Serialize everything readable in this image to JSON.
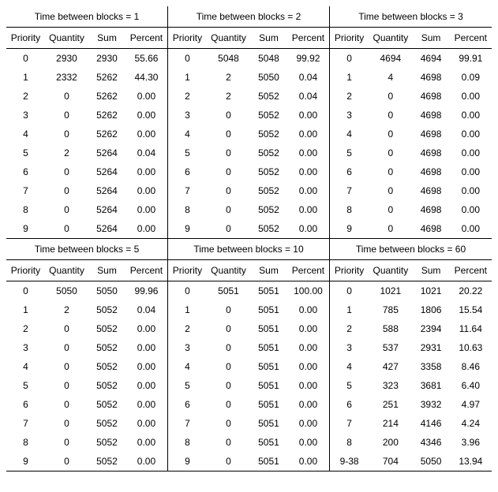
{
  "headers": {
    "priority": "Priority",
    "quantity": "Quantity",
    "sum": "Sum",
    "percent": "Percent"
  },
  "title_prefix": "Time between blocks = ",
  "blocks": [
    {
      "tbb": "1",
      "rows": [
        {
          "p": "0",
          "q": "2930",
          "s": "2930",
          "pc": "55.66"
        },
        {
          "p": "1",
          "q": "2332",
          "s": "5262",
          "pc": "44.30"
        },
        {
          "p": "2",
          "q": "0",
          "s": "5262",
          "pc": "0.00"
        },
        {
          "p": "3",
          "q": "0",
          "s": "5262",
          "pc": "0.00"
        },
        {
          "p": "4",
          "q": "0",
          "s": "5262",
          "pc": "0.00"
        },
        {
          "p": "5",
          "q": "2",
          "s": "5264",
          "pc": "0.04"
        },
        {
          "p": "6",
          "q": "0",
          "s": "5264",
          "pc": "0.00"
        },
        {
          "p": "7",
          "q": "0",
          "s": "5264",
          "pc": "0.00"
        },
        {
          "p": "8",
          "q": "0",
          "s": "5264",
          "pc": "0.00"
        },
        {
          "p": "9",
          "q": "0",
          "s": "5264",
          "pc": "0.00"
        }
      ]
    },
    {
      "tbb": "2",
      "rows": [
        {
          "p": "0",
          "q": "5048",
          "s": "5048",
          "pc": "99.92"
        },
        {
          "p": "1",
          "q": "2",
          "s": "5050",
          "pc": "0.04"
        },
        {
          "p": "2",
          "q": "2",
          "s": "5052",
          "pc": "0.04"
        },
        {
          "p": "3",
          "q": "0",
          "s": "5052",
          "pc": "0.00"
        },
        {
          "p": "4",
          "q": "0",
          "s": "5052",
          "pc": "0.00"
        },
        {
          "p": "5",
          "q": "0",
          "s": "5052",
          "pc": "0.00"
        },
        {
          "p": "6",
          "q": "0",
          "s": "5052",
          "pc": "0.00"
        },
        {
          "p": "7",
          "q": "0",
          "s": "5052",
          "pc": "0.00"
        },
        {
          "p": "8",
          "q": "0",
          "s": "5052",
          "pc": "0.00"
        },
        {
          "p": "9",
          "q": "0",
          "s": "5052",
          "pc": "0.00"
        }
      ]
    },
    {
      "tbb": "3",
      "rows": [
        {
          "p": "0",
          "q": "4694",
          "s": "4694",
          "pc": "99.91"
        },
        {
          "p": "1",
          "q": "4",
          "s": "4698",
          "pc": "0.09"
        },
        {
          "p": "2",
          "q": "0",
          "s": "4698",
          "pc": "0.00"
        },
        {
          "p": "3",
          "q": "0",
          "s": "4698",
          "pc": "0.00"
        },
        {
          "p": "4",
          "q": "0",
          "s": "4698",
          "pc": "0.00"
        },
        {
          "p": "5",
          "q": "0",
          "s": "4698",
          "pc": "0.00"
        },
        {
          "p": "6",
          "q": "0",
          "s": "4698",
          "pc": "0.00"
        },
        {
          "p": "7",
          "q": "0",
          "s": "4698",
          "pc": "0.00"
        },
        {
          "p": "8",
          "q": "0",
          "s": "4698",
          "pc": "0.00"
        },
        {
          "p": "9",
          "q": "0",
          "s": "4698",
          "pc": "0.00"
        }
      ]
    },
    {
      "tbb": "5",
      "rows": [
        {
          "p": "0",
          "q": "5050",
          "s": "5050",
          "pc": "99.96"
        },
        {
          "p": "1",
          "q": "2",
          "s": "5052",
          "pc": "0.04"
        },
        {
          "p": "2",
          "q": "0",
          "s": "5052",
          "pc": "0.00"
        },
        {
          "p": "3",
          "q": "0",
          "s": "5052",
          "pc": "0.00"
        },
        {
          "p": "4",
          "q": "0",
          "s": "5052",
          "pc": "0.00"
        },
        {
          "p": "5",
          "q": "0",
          "s": "5052",
          "pc": "0.00"
        },
        {
          "p": "6",
          "q": "0",
          "s": "5052",
          "pc": "0.00"
        },
        {
          "p": "7",
          "q": "0",
          "s": "5052",
          "pc": "0.00"
        },
        {
          "p": "8",
          "q": "0",
          "s": "5052",
          "pc": "0.00"
        },
        {
          "p": "9",
          "q": "0",
          "s": "5052",
          "pc": "0.00"
        }
      ]
    },
    {
      "tbb": "10",
      "rows": [
        {
          "p": "0",
          "q": "5051",
          "s": "5051",
          "pc": "100.00"
        },
        {
          "p": "1",
          "q": "0",
          "s": "5051",
          "pc": "0.00"
        },
        {
          "p": "2",
          "q": "0",
          "s": "5051",
          "pc": "0.00"
        },
        {
          "p": "3",
          "q": "0",
          "s": "5051",
          "pc": "0.00"
        },
        {
          "p": "4",
          "q": "0",
          "s": "5051",
          "pc": "0.00"
        },
        {
          "p": "5",
          "q": "0",
          "s": "5051",
          "pc": "0.00"
        },
        {
          "p": "6",
          "q": "0",
          "s": "5051",
          "pc": "0.00"
        },
        {
          "p": "7",
          "q": "0",
          "s": "5051",
          "pc": "0.00"
        },
        {
          "p": "8",
          "q": "0",
          "s": "5051",
          "pc": "0.00"
        },
        {
          "p": "9",
          "q": "0",
          "s": "5051",
          "pc": "0.00"
        }
      ]
    },
    {
      "tbb": "60",
      "rows": [
        {
          "p": "0",
          "q": "1021",
          "s": "1021",
          "pc": "20.22"
        },
        {
          "p": "1",
          "q": "785",
          "s": "1806",
          "pc": "15.54"
        },
        {
          "p": "2",
          "q": "588",
          "s": "2394",
          "pc": "11.64"
        },
        {
          "p": "3",
          "q": "537",
          "s": "2931",
          "pc": "10.63"
        },
        {
          "p": "4",
          "q": "427",
          "s": "3358",
          "pc": "8.46"
        },
        {
          "p": "5",
          "q": "323",
          "s": "3681",
          "pc": "6.40"
        },
        {
          "p": "6",
          "q": "251",
          "s": "3932",
          "pc": "4.97"
        },
        {
          "p": "7",
          "q": "214",
          "s": "4146",
          "pc": "4.24"
        },
        {
          "p": "8",
          "q": "200",
          "s": "4346",
          "pc": "3.96"
        },
        {
          "p": "9-38",
          "q": "704",
          "s": "5050",
          "pc": "13.94"
        }
      ]
    }
  ]
}
